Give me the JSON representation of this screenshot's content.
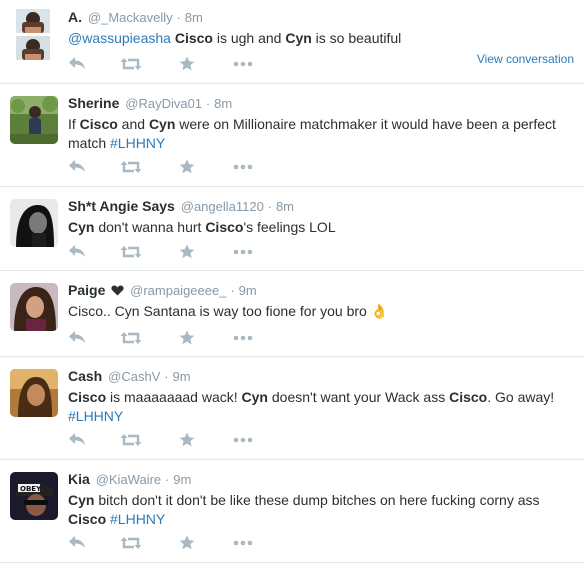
{
  "tweets": [
    {
      "fullname": "A.",
      "username": "@_Mackavelly",
      "time": "8m",
      "segments": [
        {
          "t": "@wassupieasha",
          "style": "link"
        },
        {
          "t": " ",
          "style": "plain"
        },
        {
          "t": "Cisco",
          "style": "bold"
        },
        {
          "t": " is ugh and ",
          "style": "plain"
        },
        {
          "t": "Cyn",
          "style": "bold"
        },
        {
          "t": " is so beautiful",
          "style": "plain"
        }
      ],
      "view_conversation": "View conversation",
      "avatar": "conversation-avatars"
    },
    {
      "fullname": "Sherine",
      "username": "@RayDiva01",
      "time": "8m",
      "segments": [
        {
          "t": "If ",
          "style": "plain"
        },
        {
          "t": "Cisco",
          "style": "bold"
        },
        {
          "t": " and ",
          "style": "plain"
        },
        {
          "t": "Cyn",
          "style": "bold"
        },
        {
          "t": " were on Millionaire matchmaker it would have been a perfect match ",
          "style": "plain"
        },
        {
          "t": "#LHHNY",
          "style": "link"
        }
      ],
      "avatar": "outdoor-photo"
    },
    {
      "fullname": "Sh*t Angie Says",
      "username": "@angella1120",
      "time": "8m",
      "segments": [
        {
          "t": "Cyn",
          "style": "bold"
        },
        {
          "t": " don't wanna hurt ",
          "style": "plain"
        },
        {
          "t": "Cisco",
          "style": "bold"
        },
        {
          "t": "'s feelings LOL",
          "style": "plain"
        }
      ],
      "avatar": "black-white-portrait"
    },
    {
      "fullname": "Paige",
      "username": "@rampaigeeee_",
      "time": "9m",
      "segments": [
        {
          "t": "Cisco.. Cyn Santana is way too fione for you bro ",
          "style": "plain"
        },
        {
          "t": "👌",
          "style": "emoji"
        }
      ],
      "badge_icon": "heart-icon",
      "avatar": "selfie-portrait"
    },
    {
      "fullname": "Cash",
      "username": "@CashV",
      "time": "9m",
      "segments": [
        {
          "t": "Cisco",
          "style": "bold"
        },
        {
          "t": " is maaaaaaad wack!  ",
          "style": "plain"
        },
        {
          "t": "Cyn",
          "style": "bold"
        },
        {
          "t": " doesn't want your Wack ass ",
          "style": "plain"
        },
        {
          "t": "Cisco",
          "style": "bold"
        },
        {
          "t": ". Go away! ",
          "style": "plain"
        },
        {
          "t": "#LHHNY",
          "style": "link"
        }
      ],
      "avatar": "warm-portrait"
    },
    {
      "fullname": "Kia",
      "username": "@KiaWaire",
      "time": "9m",
      "segments": [
        {
          "t": "Cyn",
          "style": "bold"
        },
        {
          "t": " bitch don't it don't be like these dump bitches on here fucking corny ass ",
          "style": "plain"
        },
        {
          "t": "Cisco",
          "style": "bold"
        },
        {
          "t": " ",
          "style": "plain"
        },
        {
          "t": "#LHHNY",
          "style": "link"
        }
      ],
      "avatar": "obey-cap-portrait"
    }
  ],
  "actions": [
    "reply-icon",
    "retweet-icon",
    "favorite-icon",
    "more-icon"
  ],
  "colors": {
    "link": "#2b7bb9",
    "muted": "#8899a6",
    "icon": "#aab8c2",
    "text": "#292f33",
    "divider": "#e1e8ed"
  }
}
